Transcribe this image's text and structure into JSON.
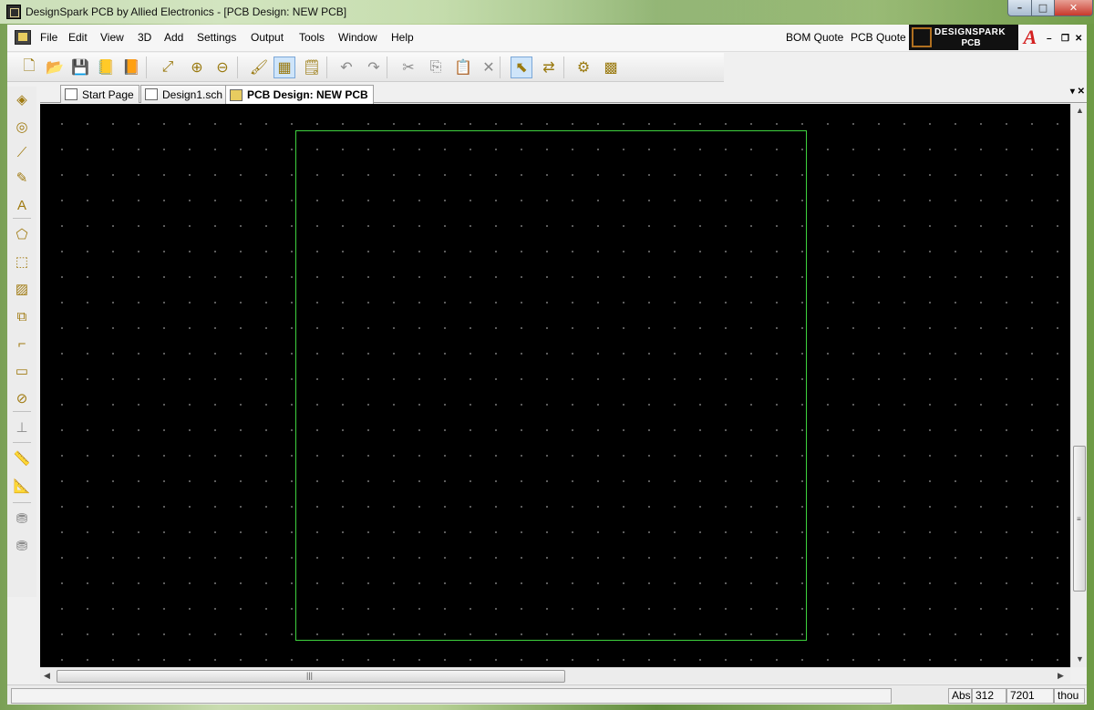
{
  "window": {
    "title": "DesignSpark PCB by Allied Electronics - [PCB Design: NEW PCB]",
    "min_glyph": "–",
    "max_glyph": "□",
    "close_glyph": "✕"
  },
  "menu": {
    "items": [
      "File",
      "Edit",
      "View",
      "3D",
      "Add",
      "Settings",
      "Output",
      "Tools",
      "Window",
      "Help"
    ],
    "bom_quote": "BOM Quote",
    "pcb_quote": "PCB Quote",
    "logo_line1": "DESIGNSPARK",
    "logo_line2": "PCB",
    "allied_mark": "A",
    "mdi_min": "–",
    "mdi_restore": "❐",
    "mdi_close": "✕"
  },
  "toolbar": {
    "buttons": [
      {
        "name": "new-icon",
        "glyph": "🗋"
      },
      {
        "name": "open-icon",
        "glyph": "📂"
      },
      {
        "name": "save-icon",
        "glyph": "💾"
      },
      {
        "name": "library-icon",
        "glyph": "📒"
      },
      {
        "name": "book-icon",
        "glyph": "📙"
      },
      {
        "name": "zoom-fit-icon",
        "glyph": "⤢"
      },
      {
        "name": "zoom-in-icon",
        "glyph": "⊕"
      },
      {
        "name": "zoom-out-icon",
        "glyph": "⊖"
      },
      {
        "name": "paint-icon",
        "glyph": "🖌"
      },
      {
        "name": "grid-icon",
        "glyph": "▦"
      },
      {
        "name": "properties-icon",
        "glyph": "🗒"
      },
      {
        "name": "undo-icon",
        "glyph": "↶"
      },
      {
        "name": "redo-icon",
        "glyph": "↷"
      },
      {
        "name": "cut-icon",
        "glyph": "✂"
      },
      {
        "name": "copy-icon",
        "glyph": "⎘"
      },
      {
        "name": "paste-icon",
        "glyph": "📋"
      },
      {
        "name": "delete-icon",
        "glyph": "✕"
      },
      {
        "name": "select-icon",
        "glyph": "⬉"
      },
      {
        "name": "interaction-icon",
        "glyph": "⇄"
      },
      {
        "name": "gears-icon",
        "glyph": "⚙"
      },
      {
        "name": "drc-icon",
        "glyph": "▩"
      }
    ]
  },
  "left_tools": [
    {
      "name": "component-icon",
      "glyph": "◈"
    },
    {
      "name": "via-icon",
      "glyph": "◎"
    },
    {
      "name": "track-icon",
      "glyph": "⟋"
    },
    {
      "name": "pen-icon",
      "glyph": "✎"
    },
    {
      "name": "text-icon",
      "glyph": "A"
    },
    {
      "name": "shape-icon",
      "glyph": "⬠"
    },
    {
      "name": "area-icon",
      "glyph": "⬚"
    },
    {
      "name": "copper-pour-icon",
      "glyph": "▨"
    },
    {
      "name": "polygon-icon",
      "glyph": "⧉"
    },
    {
      "name": "line-icon",
      "glyph": "⌐"
    },
    {
      "name": "rectangle-icon",
      "glyph": "▭"
    },
    {
      "name": "circle-icon",
      "glyph": "⊘"
    },
    {
      "name": "dimension-icon",
      "glyph": "⊥"
    },
    {
      "name": "ruler-icon",
      "glyph": "📏"
    },
    {
      "name": "measure-icon",
      "glyph": "📐"
    },
    {
      "name": "stamp-a-icon",
      "glyph": "⛃"
    },
    {
      "name": "stamp-b-icon",
      "glyph": "⛃"
    }
  ],
  "tabs": [
    {
      "label": "Start Page"
    },
    {
      "label": "Design1.sch"
    },
    {
      "label": "PCB Design: NEW PCB"
    }
  ],
  "tab_controls": "▾ ✕",
  "scroll": {
    "grip": "|||",
    "grip_v": "≡"
  },
  "status": {
    "mode": "Abs",
    "x": "312",
    "y": "7201",
    "units": "thou"
  }
}
